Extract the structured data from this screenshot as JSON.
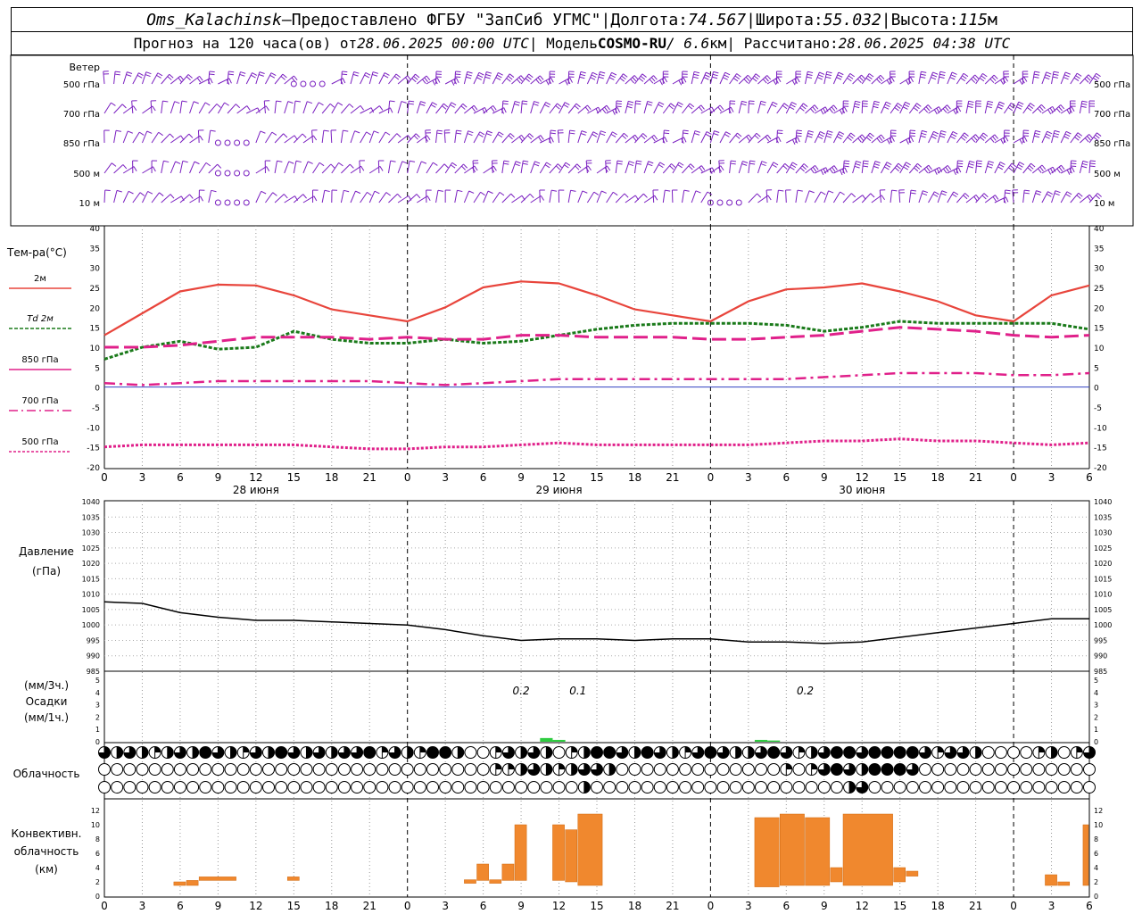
{
  "header": {
    "station": "Oms_Kalachinsk",
    "dash": " — ",
    "provider": "Предоставлено ФГБУ \"ЗапСиб УГМС\"",
    "sep": " | ",
    "lon_label": "Долгота: ",
    "lon": "74.567",
    "lat_label": "Широта: ",
    "lat": "55.032",
    "alt_label": "Высота: ",
    "alt": "115",
    "alt_unit": "м",
    "forecast_label": "Прогноз на 120 часа(ов) от ",
    "forecast_from": "28.06.2025 00:00 UTC",
    "model_label": " | Модель ",
    "model": "COSMO-RU",
    "resolution": " / 6.6",
    "res_unit": "км",
    "calc_label": " | Рассчитано: ",
    "calc_time": "28.06.2025 04:38 UTC"
  },
  "labels": {
    "wind": "Ветер",
    "levels": [
      "500 гПа",
      "700 гПа",
      "850 гПа",
      "500 м",
      "10  м"
    ],
    "temp": "Тем-ра(°C)",
    "legend": [
      {
        "label": "2м",
        "color": "#e8453c",
        "dash": ""
      },
      {
        "label": "Td  2м",
        "color": "#1a7a1a",
        "dash": "4,2"
      },
      {
        "label": "850 гПа",
        "color": "#e0208a",
        "dash": ""
      },
      {
        "label": "700 гПа",
        "color": "#e0208a",
        "dash": "10,4,2,4"
      },
      {
        "label": "500 гПа",
        "color": "#e0208a",
        "dash": "3,2"
      }
    ],
    "pressure_1": "Давление",
    "pressure_2": "(гПа)",
    "precip_1": "(мм/3ч.)",
    "precip_2": "Осадки",
    "precip_3": "(мм/1ч.)",
    "cloud": "Облачность",
    "conv_1": "Конвективн.",
    "conv_2": "облачность",
    "conv_3": "(км)",
    "days": [
      "28 июня",
      "29 июня",
      "30 июня"
    ],
    "precip_values": [
      "0.2",
      "0.1",
      "0.2"
    ]
  },
  "chart_data": [
    {
      "type": "line",
      "name": "temperature",
      "x_hours": [
        0,
        3,
        6,
        9,
        12,
        15,
        18,
        21,
        24,
        27,
        30,
        33,
        36,
        39,
        42,
        45,
        48,
        51,
        54,
        57,
        60,
        63,
        66,
        69,
        72,
        75,
        78
      ],
      "x_tick_labels": [
        "0",
        "3",
        "6",
        "9",
        "12",
        "15",
        "18",
        "21",
        "0",
        "3",
        "6",
        "9",
        "12",
        "15",
        "18",
        "21",
        "0",
        "3",
        "6",
        "9",
        "12",
        "15",
        "18",
        "21",
        "0",
        "3",
        "6"
      ],
      "ylim": [
        -20,
        40
      ],
      "y_ticks": [
        -20,
        -15,
        -10,
        -5,
        0,
        5,
        10,
        15,
        20,
        25,
        30,
        35,
        40
      ],
      "series": [
        {
          "name": "2м",
          "color": "#e8453c",
          "values": [
            13,
            18.5,
            24,
            25.7,
            25.5,
            23,
            19.5,
            18,
            16.5,
            20,
            25,
            26.5,
            26,
            23,
            19.5,
            18,
            16.5,
            21.5,
            24.5,
            25,
            26,
            24,
            21.5,
            18,
            16.5,
            23,
            25.5
          ]
        },
        {
          "name": "Td  2м",
          "color": "#1a7a1a",
          "values": [
            7,
            10,
            11.5,
            9.5,
            10,
            14,
            12,
            11,
            11,
            12,
            11,
            11.5,
            13,
            14.5,
            15.5,
            16,
            16,
            16,
            15.5,
            14,
            15,
            16.5,
            16,
            16,
            16,
            16,
            14.5
          ]
        },
        {
          "name": "850 гПа",
          "color": "#e0208a",
          "values": [
            10,
            10,
            10.5,
            11.5,
            12.5,
            12.5,
            12.5,
            12,
            12.5,
            12,
            12,
            13,
            13,
            12.5,
            12.5,
            12.5,
            12,
            12,
            12.5,
            13,
            14,
            15,
            14.5,
            14,
            13,
            12.5,
            13
          ]
        },
        {
          "name": "700 гПа",
          "color": "#e0208a",
          "values": [
            1,
            0.5,
            1,
            1.5,
            1.5,
            1.5,
            1.5,
            1.5,
            1,
            0.5,
            1,
            1.5,
            2,
            2,
            2,
            2,
            2,
            2,
            2,
            2.5,
            3,
            3.5,
            3.5,
            3.5,
            3,
            3,
            3.5
          ]
        },
        {
          "name": "500 гПа",
          "color": "#e0208a",
          "values": [
            -15,
            -14.5,
            -14.5,
            -14.5,
            -14.5,
            -14.5,
            -15,
            -15.5,
            -15.5,
            -15,
            -15,
            -14.5,
            -14,
            -14.5,
            -14.5,
            -14.5,
            -14.5,
            -14.5,
            -14,
            -13.5,
            -13.5,
            -13,
            -13.5,
            -13.5,
            -14,
            -14.5,
            -14
          ]
        }
      ]
    },
    {
      "type": "line",
      "name": "pressure",
      "ylim": [
        985,
        1040
      ],
      "y_ticks": [
        985,
        990,
        995,
        1000,
        1005,
        1010,
        1015,
        1020,
        1025,
        1030,
        1035,
        1040
      ],
      "values": [
        1007.5,
        1007,
        1004,
        1002.5,
        1001.5,
        1001.5,
        1001,
        1000.5,
        1000,
        998.5,
        996.5,
        995,
        995.5,
        995.5,
        995,
        995.5,
        995.5,
        994.5,
        994.5,
        994,
        994.5,
        996,
        997.5,
        999,
        1000.5,
        1002,
        1002
      ]
    },
    {
      "type": "bar",
      "name": "precipitation",
      "ylim": [
        0,
        5
      ],
      "y_ticks": [
        0,
        1,
        2,
        3,
        4,
        5
      ],
      "bars": [
        {
          "hour": 35,
          "value": 0.3
        },
        {
          "hour": 36,
          "value": 0.15
        },
        {
          "hour": 52,
          "value": 0.15
        },
        {
          "hour": 53,
          "value": 0.1
        }
      ]
    },
    {
      "type": "bar",
      "name": "convective_cloud",
      "ylim": [
        0,
        13
      ],
      "y_ticks": [
        0,
        2,
        4,
        6,
        8,
        10,
        12
      ],
      "bars": [
        {
          "h0": 5.5,
          "h1": 6.5,
          "bottom": 1.5,
          "top": 2
        },
        {
          "h0": 6.5,
          "h1": 7.5,
          "bottom": 1.5,
          "top": 2.2
        },
        {
          "h0": 7.5,
          "h1": 10.5,
          "bottom": 2.2,
          "top": 2.7
        },
        {
          "h0": 14.5,
          "h1": 15.5,
          "bottom": 2.2,
          "top": 2.7
        },
        {
          "h0": 28.5,
          "h1": 29.5,
          "bottom": 1.8,
          "top": 2.3
        },
        {
          "h0": 29.5,
          "h1": 30.5,
          "bottom": 2.2,
          "top": 4.5
        },
        {
          "h0": 30.5,
          "h1": 31.5,
          "bottom": 1.8,
          "top": 2.3
        },
        {
          "h0": 31.5,
          "h1": 32.5,
          "bottom": 2.2,
          "top": 4.5
        },
        {
          "h0": 32.5,
          "h1": 33.5,
          "bottom": 2.2,
          "top": 10
        },
        {
          "h0": 35.5,
          "h1": 36.5,
          "bottom": 2.2,
          "top": 10
        },
        {
          "h0": 36.5,
          "h1": 37.5,
          "bottom": 2,
          "top": 9.3
        },
        {
          "h0": 37.5,
          "h1": 39.5,
          "bottom": 1.5,
          "top": 11.5
        },
        {
          "h0": 51.5,
          "h1": 53.5,
          "bottom": 1.3,
          "top": 11
        },
        {
          "h0": 53.5,
          "h1": 55.5,
          "bottom": 1.5,
          "top": 11.5
        },
        {
          "h0": 55.5,
          "h1": 57.5,
          "bottom": 1.5,
          "top": 11
        },
        {
          "h0": 57.5,
          "h1": 58.5,
          "bottom": 2,
          "top": 4
        },
        {
          "h0": 58.5,
          "h1": 62.5,
          "bottom": 1.5,
          "top": 11.5
        },
        {
          "h0": 62.5,
          "h1": 63.5,
          "bottom": 2,
          "top": 4
        },
        {
          "h0": 63.5,
          "h1": 64.5,
          "bottom": 2.8,
          "top": 3.5
        },
        {
          "h0": 74.5,
          "h1": 75.5,
          "bottom": 1.5,
          "top": 3
        },
        {
          "h0": 75.5,
          "h1": 76.5,
          "bottom": 1.5,
          "top": 2
        },
        {
          "h0": 77.5,
          "h1": 78,
          "bottom": 1.5,
          "top": 10
        }
      ]
    },
    {
      "type": "heatmap",
      "name": "cloud_cover_eighths",
      "rows": [
        [
          6,
          4,
          6,
          4,
          2,
          4,
          6,
          4,
          8,
          6,
          4,
          2,
          6,
          4,
          8,
          6,
          4,
          6,
          4,
          6,
          6,
          8,
          2,
          6,
          4,
          2,
          8,
          8,
          4,
          0,
          0,
          2,
          6,
          4,
          6,
          4,
          0,
          2,
          4,
          8,
          8,
          6,
          4,
          8,
          6,
          4,
          2,
          6,
          8,
          6,
          4,
          4,
          6,
          8,
          6,
          2,
          4,
          6,
          8,
          8,
          6,
          8,
          8,
          8,
          8,
          6,
          2,
          6,
          6,
          4,
          0,
          0,
          0,
          0,
          2,
          4,
          0,
          2,
          6
        ],
        [
          0,
          0,
          0,
          0,
          0,
          0,
          0,
          0,
          0,
          0,
          0,
          0,
          0,
          0,
          0,
          0,
          0,
          0,
          0,
          0,
          0,
          0,
          0,
          0,
          0,
          0,
          0,
          0,
          0,
          0,
          0,
          2,
          2,
          4,
          6,
          4,
          2,
          4,
          6,
          6,
          4,
          0,
          0,
          0,
          0,
          0,
          0,
          0,
          0,
          0,
          0,
          0,
          0,
          0,
          2,
          0,
          2,
          6,
          8,
          6,
          4,
          8,
          8,
          8,
          6,
          0,
          0,
          0,
          0,
          0,
          0,
          0,
          0,
          0,
          0,
          0,
          0,
          0,
          0
        ],
        [
          0,
          0,
          0,
          0,
          0,
          0,
          0,
          0,
          0,
          0,
          0,
          0,
          0,
          0,
          0,
          0,
          0,
          0,
          0,
          0,
          0,
          0,
          0,
          0,
          0,
          0,
          0,
          0,
          0,
          0,
          0,
          0,
          0,
          0,
          0,
          0,
          0,
          0,
          4,
          0,
          0,
          0,
          0,
          0,
          0,
          0,
          0,
          0,
          0,
          0,
          0,
          0,
          0,
          0,
          0,
          0,
          0,
          0,
          0,
          4,
          6,
          0,
          0,
          0,
          0,
          0,
          0,
          0,
          0,
          0,
          0,
          0,
          0,
          0,
          0,
          0,
          0,
          0,
          0
        ]
      ]
    },
    {
      "type": "scatter",
      "name": "wind",
      "rows": [
        "500 гПа",
        "700 гПа",
        "850 гПа",
        "500 м",
        "10  м"
      ],
      "speed_ms": [
        [
          10,
          10,
          10,
          10,
          10,
          0,
          10,
          10,
          15,
          15,
          15,
          15,
          15,
          15,
          15,
          15,
          15,
          15,
          15,
          15,
          15,
          15,
          15,
          15,
          20,
          20,
          20
        ],
        [
          5,
          5,
          5,
          5,
          5,
          5,
          5,
          5,
          10,
          10,
          10,
          10,
          10,
          15,
          10,
          10,
          10,
          10,
          15,
          15,
          15,
          15,
          15,
          15,
          15,
          15,
          15
        ],
        [
          5,
          5,
          5,
          0,
          5,
          5,
          5,
          5,
          10,
          10,
          10,
          10,
          10,
          10,
          10,
          10,
          10,
          10,
          15,
          15,
          15,
          15,
          15,
          15,
          15,
          15,
          15
        ],
        [
          5,
          5,
          5,
          0,
          5,
          5,
          5,
          5,
          5,
          10,
          10,
          10,
          10,
          10,
          10,
          10,
          10,
          10,
          15,
          15,
          15,
          15,
          15,
          15,
          15,
          15,
          15
        ],
        [
          5,
          5,
          5,
          0,
          5,
          5,
          5,
          5,
          5,
          5,
          5,
          5,
          5,
          5,
          5,
          5,
          0,
          5,
          5,
          5,
          5,
          10,
          10,
          10,
          10,
          10,
          10
        ]
      ]
    }
  ]
}
